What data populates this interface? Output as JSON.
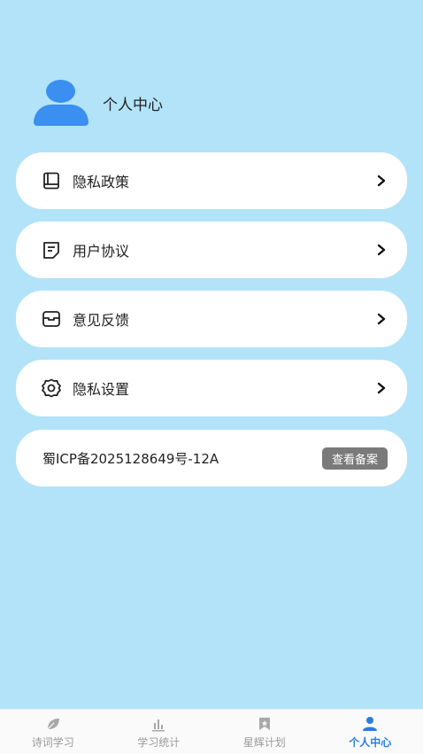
{
  "profile": {
    "name": "个人中心",
    "avatar_icon": "user-icon"
  },
  "menu": [
    {
      "label": "隐私政策",
      "icon": "book-icon"
    },
    {
      "label": "用户协议",
      "icon": "document-icon"
    },
    {
      "label": "意见反馈",
      "icon": "feedback-box-icon"
    },
    {
      "label": "隐私设置",
      "icon": "gear-icon"
    }
  ],
  "icp": {
    "text": "蜀ICP备2025128649号-12A",
    "button": "查看备案"
  },
  "tabs": [
    {
      "label": "诗词学习",
      "icon": "leaf-icon",
      "active": false
    },
    {
      "label": "学习统计",
      "icon": "bar-chart-icon",
      "active": false
    },
    {
      "label": "星辉计划",
      "icon": "bookmark-icon",
      "active": false
    },
    {
      "label": "个人中心",
      "icon": "user-icon",
      "active": true
    }
  ],
  "colors": {
    "background": "#b3e3f8",
    "accent": "#3a8ff0",
    "active_tab": "#2a7de0"
  }
}
